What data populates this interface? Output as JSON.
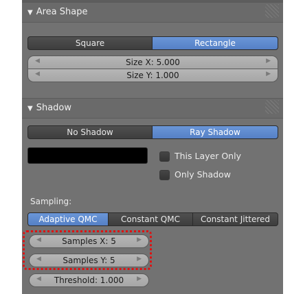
{
  "area_shape": {
    "title": "Area Shape",
    "tabs": [
      {
        "label": "Square",
        "selected": false
      },
      {
        "label": "Rectangle",
        "selected": true
      }
    ],
    "size_x": "Size X: 5.000",
    "size_y": "Size Y: 1.000"
  },
  "shadow": {
    "title": "Shadow",
    "tabs": [
      {
        "label": "No Shadow",
        "selected": false
      },
      {
        "label": "Ray Shadow",
        "selected": true
      }
    ],
    "color": "#000000",
    "this_layer_only": "This Layer Only",
    "only_shadow": "Only Shadow",
    "sampling_label": "Sampling:",
    "sampling_tabs": [
      {
        "label": "Adaptive QMC",
        "selected": true
      },
      {
        "label": "Constant QMC",
        "selected": false
      },
      {
        "label": "Constant Jittered",
        "selected": false
      }
    ],
    "samples_x": "Samples X: 5",
    "samples_y": "Samples Y: 5",
    "threshold": "Threshold: 1.000"
  },
  "icons": {
    "disclosure": "triangle-down-icon",
    "arrows": [
      "arrow-left-icon",
      "arrow-right-icon"
    ]
  },
  "colors": {
    "selected": "#5a86cc",
    "highlight": "#e01010"
  }
}
